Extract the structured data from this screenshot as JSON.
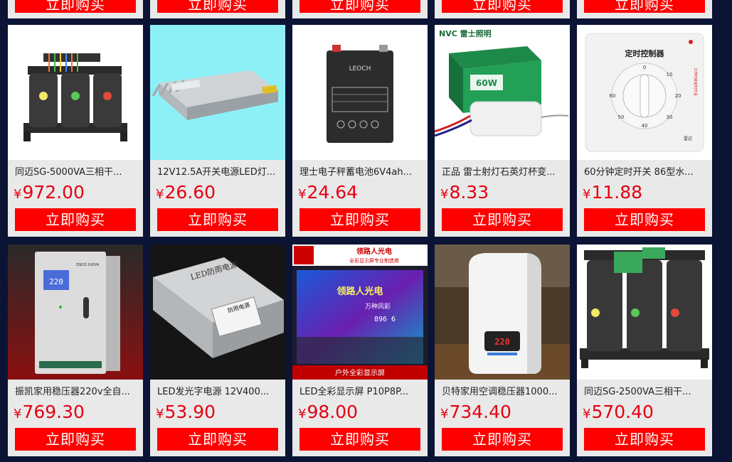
{
  "buy_label": "立即购买",
  "currency_symbol": "¥",
  "colors": {
    "background": "#0b1434",
    "card": "#e9e9e9",
    "button": "#fe0000",
    "price": "#e60012"
  },
  "products_row1": [
    {
      "title": "同迈SG-5000VA三相干...",
      "price": "972.00",
      "image": "three-phase-transformer-image"
    },
    {
      "title": "12V12.5A开关电源LED灯...",
      "price": "26.60",
      "image": "switching-power-supply-image"
    },
    {
      "title": "理士电子秤蓄电池6V4ah...",
      "price": "24.64",
      "image": "lead-acid-battery-image"
    },
    {
      "title": "正品 雷士射灯石英灯杯变...",
      "price": "8.33",
      "image": "lamp-transformer-image"
    },
    {
      "title": "60分钟定时开关 86型水...",
      "price": "11.88",
      "image": "timer-switch-image"
    }
  ],
  "products_row2": [
    {
      "title": "振凯家用稳压器220v全自...",
      "price": "769.30",
      "image": "voltage-stabilizer-image"
    },
    {
      "title": "LED发光字电源 12V400...",
      "price": "53.90",
      "image": "rainproof-power-supply-image"
    },
    {
      "title": "LED全彩显示屏 P10P8P...",
      "price": "98.00",
      "image": "led-display-screen-image"
    },
    {
      "title": "贝特家用空调稳压器1000...",
      "price": "734.40",
      "image": "ac-voltage-stabilizer-image"
    },
    {
      "title": "同迈SG-2500VA三相干...",
      "price": "570.40",
      "image": "three-phase-transformer-small-image"
    }
  ],
  "image_text": {
    "battery_brand": "LEOCH",
    "timer_title": "定时控制器",
    "timer_side": "工作时钟定时开关",
    "timer_brand": "雷迈",
    "nvc_logo": "NVC 雷士照明",
    "nvc_box_label": "60W",
    "rain_label1": "LED防雨电源",
    "rain_label2": "防雨电源",
    "led_banner": "领路人光电",
    "led_banner_sub": "全彩显示屏专业制造商",
    "led_screen_text": "领路人光电",
    "led_screen_text2": "万种风彩",
    "led_screen_num": "896 6",
    "led_bottom": "户外全彩显示屏",
    "stab_brand": "ZNDZ-10KVA",
    "stab_display": "220",
    "ac_display": "220"
  }
}
